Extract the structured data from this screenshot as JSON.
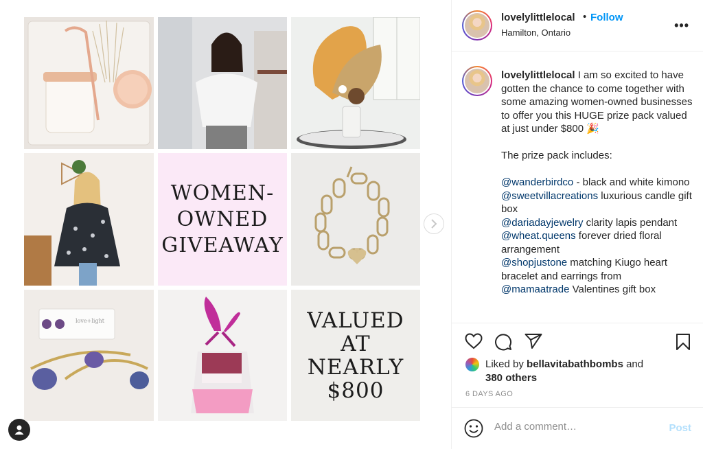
{
  "media": {
    "tile5_lines": [
      "WOMEN-",
      "OWNED",
      "GIVEAWAY"
    ],
    "tile9_lines": [
      "VALUED",
      "AT",
      "NEARLY",
      "$800"
    ],
    "next_icon": "chevron-right-icon",
    "user_icon": "user-icon"
  },
  "header": {
    "username": "lovelylittlelocal",
    "dot": "•",
    "follow": "Follow",
    "location": "Hamilton, Ontario",
    "more": "•••"
  },
  "caption": {
    "username": "lovelylittlelocal",
    "intro": " I am so excited to have gotten the chance to come together with some amazing women-owned businesses to offer you this HUGE prize pack valued at just under $800 🎉",
    "prize_heading": "The prize pack includes:",
    "items": [
      {
        "mention": "@wanderbirdco",
        "text": " - black and white kimono"
      },
      {
        "mention": "@sweetvillacreations",
        "text": " luxurious candle gift box"
      },
      {
        "mention": "@dariadayjewelry",
        "text": " clarity lapis pendant"
      },
      {
        "mention": "@wheat.queens",
        "text": " forever dried floral arrangement"
      },
      {
        "mention": "@shopjustone",
        "text": " matching Kiugo heart bracelet and earrings from"
      },
      {
        "mention": "@mamaatrade",
        "text": " Valentines gift box"
      }
    ]
  },
  "actions": {
    "liked_prefix": "Liked by ",
    "liked_user": "bellavitabathbombs",
    "liked_suffix": " and",
    "others": "380 others",
    "time": "6 DAYS AGO"
  },
  "comment": {
    "placeholder": "Add a comment…",
    "post": "Post"
  },
  "colors": {
    "follow_blue": "#0095f6",
    "mention_blue": "#00376b",
    "post_disabled": "#b2dffc",
    "muted": "#8e8e8e"
  }
}
